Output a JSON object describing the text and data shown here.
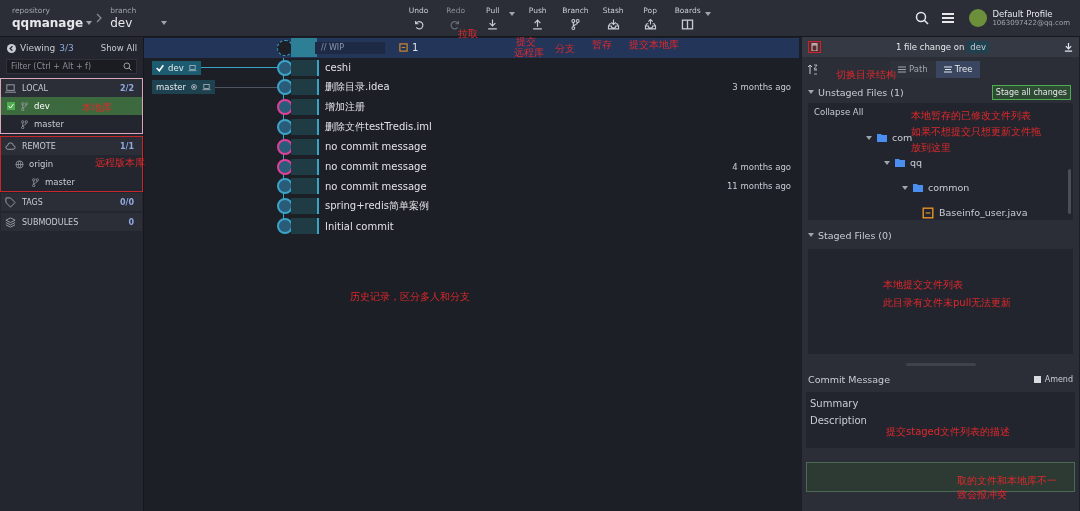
{
  "header": {
    "repository_label": "repository",
    "repository": "qqmanage",
    "branch_label": "branch",
    "branch": "dev"
  },
  "toolbar": [
    {
      "label": "Undo",
      "kind": "undo",
      "disabled": false,
      "caret": false
    },
    {
      "label": "Redo",
      "kind": "redo",
      "disabled": true,
      "caret": false
    },
    {
      "label": "Pull",
      "kind": "pull",
      "disabled": false,
      "caret": true
    },
    {
      "label": "Push",
      "kind": "push",
      "disabled": false,
      "caret": false
    },
    {
      "label": "Branch",
      "kind": "branch",
      "disabled": false,
      "caret": false
    },
    {
      "label": "Stash",
      "kind": "stash",
      "disabled": false,
      "caret": false
    },
    {
      "label": "Pop",
      "kind": "pop",
      "disabled": false,
      "caret": false
    },
    {
      "label": "Boards",
      "kind": "boards",
      "disabled": false,
      "caret": true
    }
  ],
  "profile": {
    "name": "Default Profile",
    "email": "1063097422@qq.com"
  },
  "sidebar": {
    "viewing_label": "Viewing",
    "viewing_count": "3/3",
    "show_all": "Show All",
    "filter_placeholder": "Filter (Ctrl + Alt + f)",
    "sections": [
      {
        "kind": "local",
        "title": "LOCAL",
        "count": "2/2",
        "items": [
          {
            "label": "dev",
            "selected": true,
            "checked": true
          },
          {
            "label": "master",
            "selected": false,
            "checked": false
          }
        ]
      },
      {
        "kind": "remote",
        "title": "REMOTE",
        "count": "1/1",
        "items": [
          {
            "label": "origin",
            "children": [
              {
                "label": "master"
              }
            ]
          }
        ]
      },
      {
        "kind": "tags",
        "title": "TAGS",
        "count": "0/0"
      },
      {
        "kind": "submodules",
        "title": "SUBMODULES",
        "count": "0"
      }
    ]
  },
  "graph": {
    "wip": {
      "placeholder": "// WIP",
      "file_count": "1"
    },
    "branch_labels": [
      {
        "name": "dev",
        "checked": true
      },
      {
        "name": "master",
        "checked": false
      }
    ],
    "commits": [
      {
        "message": "ceshi",
        "color": "#3aa3c8"
      },
      {
        "message": "删除目录.idea",
        "time": "3 months ago",
        "color": "#3aa3c8"
      },
      {
        "message": "增加注册",
        "color": "#e0409a"
      },
      {
        "message": "删除文件testTredis.iml",
        "color": "#3aa3c8"
      },
      {
        "message": "no commit message",
        "color": "#e0409a"
      },
      {
        "message": "no commit message",
        "time": "4 months ago",
        "color": "#e0409a"
      },
      {
        "message": "no commit message",
        "time": "11 months ago",
        "color": "#3aa3c8"
      },
      {
        "message": "spring+redis简单案例",
        "color": "#3aa3c8"
      },
      {
        "message": "Initial commit",
        "color": "#3aa3c8"
      }
    ]
  },
  "panel": {
    "change_text": "1 file change on",
    "change_branch": "dev",
    "view_modes": [
      {
        "label": "Path",
        "selected": false
      },
      {
        "label": "Tree",
        "selected": true
      }
    ],
    "unstaged": {
      "title": "Unstaged Files (1)",
      "stage_all": "Stage all changes",
      "collapse_all": "Collapse All",
      "tree": [
        {
          "label": "com",
          "expanded": true,
          "children": [
            {
              "label": "qq",
              "expanded": true,
              "children": [
                {
                  "label": "common",
                  "expanded": true,
                  "children": [
                    {
                      "label": "Baseinfo_user.java",
                      "kind": "file"
                    }
                  ]
                }
              ]
            }
          ]
        }
      ]
    },
    "staged": {
      "title": "Staged Files (0)"
    },
    "commit": {
      "title": "Commit Message",
      "amend_label": "Amend",
      "amend": false,
      "summary_placeholder": "Summary",
      "description_placeholder": "Description"
    }
  },
  "annotations": [
    "拉取",
    "提交",
    "远程库",
    "分支",
    "暂存",
    "提交本地库",
    "本地库",
    "远程版本库",
    "历史记录，区分多人和分支",
    "切换目录结构",
    "本地暂存的已修改文件列表",
    "如果不想提交只想更新文件拖",
    "放到这里",
    "本地提交文件列表",
    "此目录有文件未pull无法更新",
    "提交staged文件列表的描述",
    "取的文件和本地库不一",
    "致会报冲突"
  ]
}
